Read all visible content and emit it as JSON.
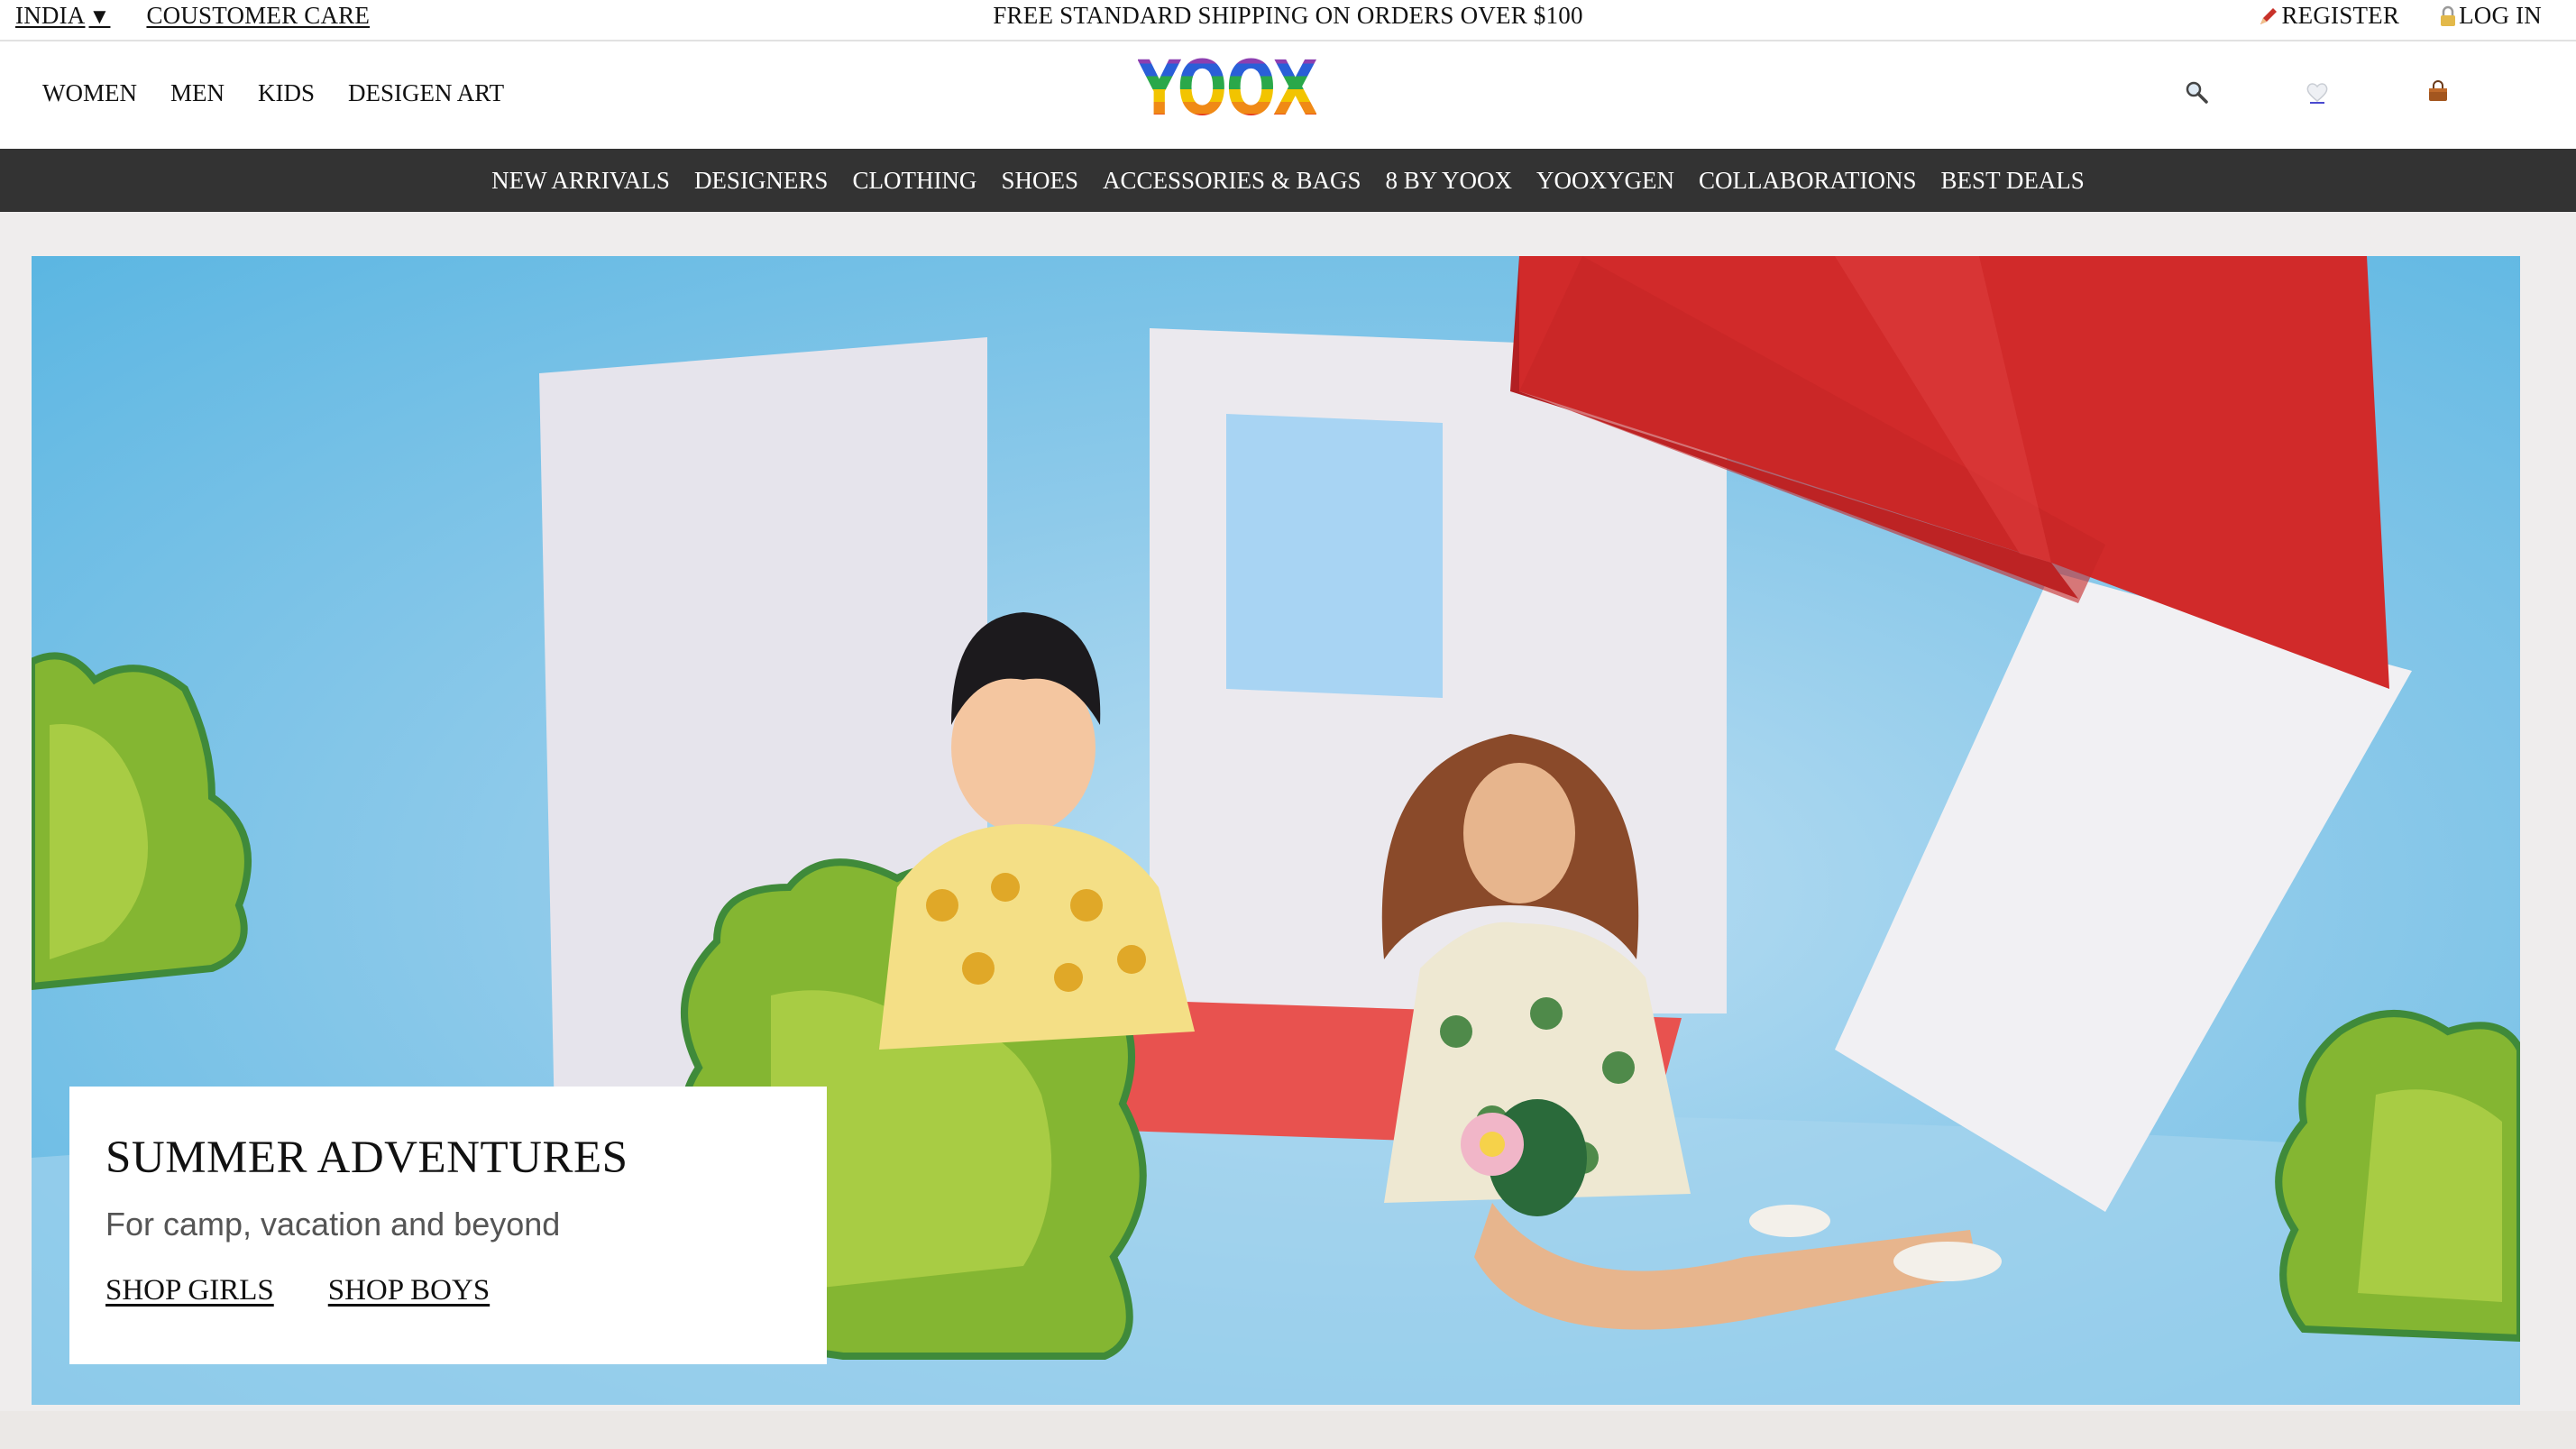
{
  "topbar": {
    "country": "INDIA",
    "customer_care": "COUSTOMER CARE",
    "shipping": "FREE STANDARD SHIPPING ON ORDERS OVER $100",
    "register": "REGISTER",
    "login": "LOG IN"
  },
  "header": {
    "nav": [
      "WOMEN",
      "MEN",
      "KIDS",
      "DESIGEN ART"
    ],
    "logo": "YOOX",
    "icons": [
      "search-icon",
      "heart-icon",
      "shopping-bag-icon"
    ]
  },
  "categories": [
    "NEW ARRIVALS",
    "DESIGNERS",
    "CLOTHING",
    "SHOES",
    "ACCESSORIES & BAGS",
    "8 BY YOOX",
    "YOOXYGEN",
    "COLLABORATIONS",
    "BEST DEALS"
  ],
  "hero": {
    "title": "SUMMER ADVENTURES",
    "subtitle": "For camp, vacation and beyond",
    "links": [
      "SHOP GIRLS",
      "SHOP BOYS"
    ]
  },
  "colors": {
    "category_bar": "#333333",
    "hero_sky": "#8ecaea",
    "roof_red": "#d12a2a",
    "bush_green": "#8fbf3a"
  }
}
